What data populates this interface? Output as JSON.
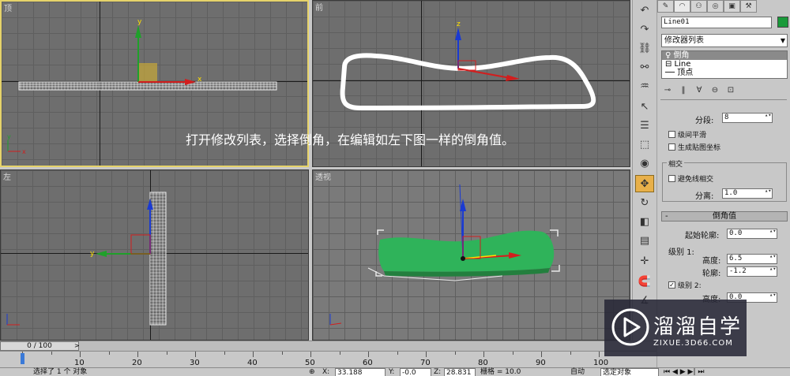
{
  "viewports": {
    "top_label": "顶",
    "front_label": "前",
    "left_label": "左",
    "persp_label": "透视"
  },
  "instruction_text": "打开修改列表，选择倒角，在编辑如左下图一样的倒角值。",
  "panel": {
    "object_name": "Line01",
    "object_color": "#1a9a3a",
    "modifier_list": "修改器列表",
    "stack": [
      "倒角",
      "⊟ Line",
      "── 顶点"
    ],
    "segments_label": "分段:",
    "segments_value": "8",
    "smooth_label": "级间平滑",
    "mapcoords_label": "生成贴图坐标",
    "intersect_group": "相交",
    "avoid_label": "避免线相交",
    "separation_label": "分离:",
    "separation_value": "1.0",
    "bevel_values_header": "倒角值",
    "start_outline_label": "起始轮廓:",
    "start_outline_value": "0.0",
    "level1_label": "级别 1:",
    "height_label": "高度:",
    "level1_height": "6.5",
    "outline_label": "轮廓:",
    "level1_outline": "-1.2",
    "level2_label": "级别 2:",
    "level2_height": "0.0"
  },
  "timeline": {
    "slider_text": "0 / 100",
    "ticks": [
      "10",
      "20",
      "30",
      "40",
      "50",
      "60",
      "70",
      "80",
      "90",
      "100"
    ]
  },
  "status": {
    "selected": "选择了 1 个 对象",
    "x_value": "33.188",
    "y_value": "-0.0",
    "z_value": "28.831",
    "grid": "栅格 = 10.0",
    "autokey": "自动",
    "selected_obj": "选定对象"
  },
  "watermark": {
    "title": "溜溜自学",
    "url": "ZIXUE.3D66.COM"
  },
  "colors": {
    "active_viewport": "#e6d36a",
    "shape_green": "#2fb35a",
    "axis_red": "#d21e1e",
    "axis_green": "#1fa02a",
    "axis_blue": "#1a3ad2"
  }
}
